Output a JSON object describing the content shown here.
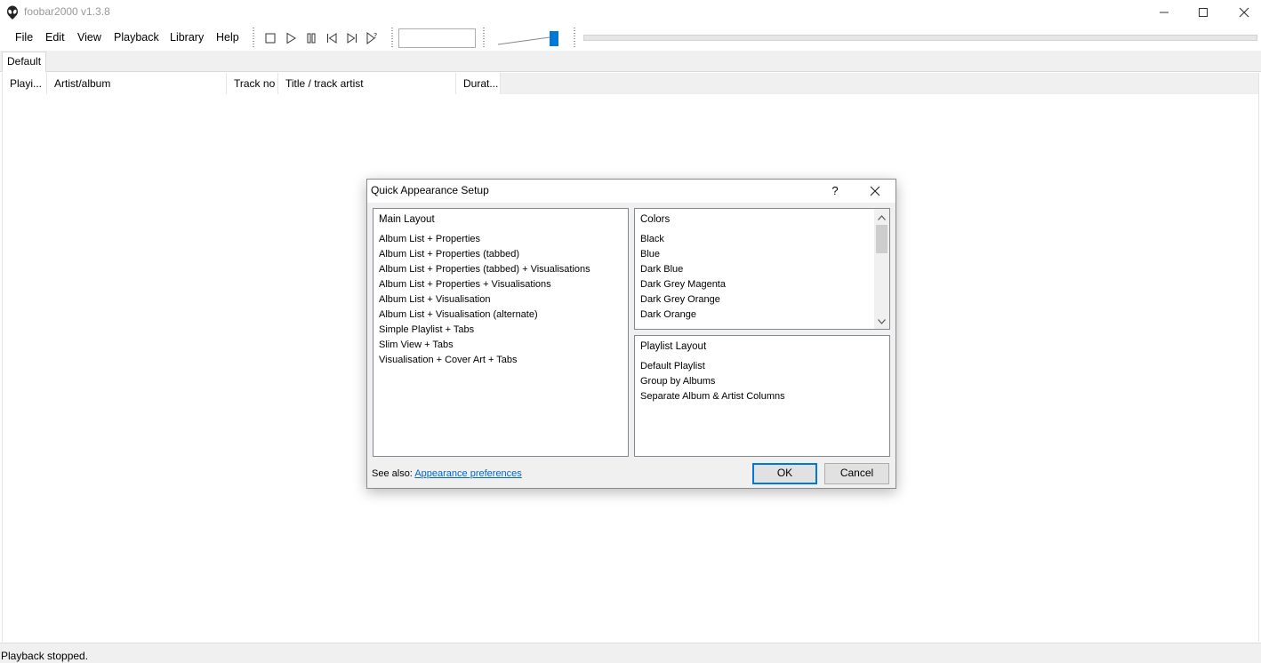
{
  "window": {
    "title": "foobar2000 v1.3.8",
    "icon": "alien-icon",
    "controls": [
      "minimize-icon",
      "maximize-icon",
      "close-icon"
    ]
  },
  "menu": {
    "items": [
      {
        "label": "File"
      },
      {
        "label": "Edit"
      },
      {
        "label": "View"
      },
      {
        "label": "Playback"
      },
      {
        "label": "Library"
      },
      {
        "label": "Help"
      }
    ]
  },
  "toolbar": {
    "buttons": [
      "stop-icon",
      "play-icon",
      "pause-icon",
      "previous-icon",
      "next-icon",
      "random-icon"
    ],
    "volume_level": 1.0,
    "accent": "#0078d7"
  },
  "tabs": [
    {
      "label": "Default"
    }
  ],
  "playlist": {
    "columns": [
      {
        "label": "Playi..."
      },
      {
        "label": "Artist/album"
      },
      {
        "label": "Track no"
      },
      {
        "label": "Title / track artist"
      },
      {
        "label": "Durat..."
      }
    ]
  },
  "status": {
    "text": "Playback stopped."
  },
  "dialog": {
    "title": "Quick Appearance Setup",
    "help_label": "?",
    "main_layout": {
      "heading": "Main Layout",
      "items": [
        "Album List + Properties",
        "Album List + Properties (tabbed)",
        "Album List + Properties (tabbed) + Visualisations",
        "Album List + Properties + Visualisations",
        "Album List + Visualisation",
        "Album List + Visualisation (alternate)",
        "Simple Playlist + Tabs",
        "Slim View + Tabs",
        "Visualisation + Cover Art + Tabs"
      ]
    },
    "colors": {
      "heading": "Colors",
      "items": [
        "Black",
        "Blue",
        "Dark Blue",
        "Dark Grey Magenta",
        "Dark Grey Orange",
        "Dark Orange"
      ]
    },
    "playlist_layout": {
      "heading": "Playlist Layout",
      "items": [
        "Default Playlist",
        "Group by Albums",
        "Separate Album & Artist Columns"
      ]
    },
    "see_also_label": "See also:",
    "see_also_link": "Appearance preferences",
    "ok_label": "OK",
    "cancel_label": "Cancel"
  }
}
